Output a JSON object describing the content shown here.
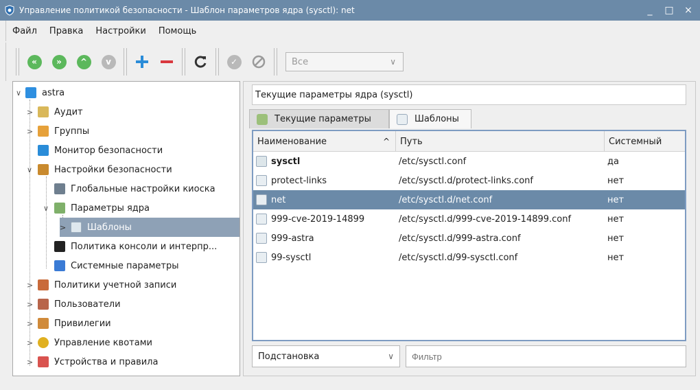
{
  "window": {
    "title": "Управление политикой безопасности - Шаблон параметров ядра (sysctl): net",
    "minimize": "_",
    "maximize": "□",
    "close": "×"
  },
  "menu": [
    "Файл",
    "Правка",
    "Настройки",
    "Помощь"
  ],
  "toolbar": {
    "filter_combo": "Все",
    "colors": {
      "green": "#5cb85c",
      "gray": "#b9b9b9",
      "blue": "#2a8cd8",
      "red": "#d9383e",
      "dark": "#333333"
    }
  },
  "tree": {
    "root": "astra",
    "items": [
      {
        "label": "Аудит",
        "icon": "audit-icon"
      },
      {
        "label": "Группы",
        "icon": "groups-icon"
      },
      {
        "label": "Монитор безопасности",
        "icon": "monitor-icon"
      },
      {
        "label": "Настройки безопасности",
        "icon": "settings-icon"
      },
      {
        "label": "Глобальные настройки киоска",
        "icon": "kiosk-icon"
      },
      {
        "label": "Параметры ядра",
        "icon": "kernel-icon"
      },
      {
        "label": "Шаблоны",
        "icon": "templates-icon"
      },
      {
        "label": "Политика консоли и интерпр...",
        "icon": "console-icon"
      },
      {
        "label": "Системные параметры",
        "icon": "system-icon"
      },
      {
        "label": "Политики учетной записи",
        "icon": "account-icon"
      },
      {
        "label": "Пользователи",
        "icon": "users-icon"
      },
      {
        "label": "Привилегии",
        "icon": "privileges-icon"
      },
      {
        "label": "Управление квотами",
        "icon": "quota-icon"
      },
      {
        "label": "Устройства и правила",
        "icon": "devices-icon"
      }
    ]
  },
  "main": {
    "header": "Текущие параметры ядра (sysctl)",
    "tabs": [
      {
        "label": "Текущие параметры"
      },
      {
        "label": "Шаблоны"
      }
    ],
    "table": {
      "columns": [
        "Наименование",
        "Путь",
        "Системный"
      ],
      "sort_indicator": "^",
      "rows": [
        {
          "name": "sysctl",
          "path": "/etc/sysctl.conf",
          "system": "да"
        },
        {
          "name": "protect-links",
          "path": "/etc/sysctl.d/protect-links.conf",
          "system": "нет"
        },
        {
          "name": "net",
          "path": "/etc/sysctl.d/net.conf",
          "system": "нет"
        },
        {
          "name": "999-cve-2019-14899",
          "path": "/etc/sysctl.d/999-cve-2019-14899.conf",
          "system": "нет"
        },
        {
          "name": "999-astra",
          "path": "/etc/sysctl.d/999-astra.conf",
          "system": "нет"
        },
        {
          "name": "99-sysctl",
          "path": "/etc/sysctl.d/99-sysctl.conf",
          "system": "нет"
        }
      ]
    },
    "mode_combo": "Подстановка",
    "filter_placeholder": "Фильтр"
  }
}
